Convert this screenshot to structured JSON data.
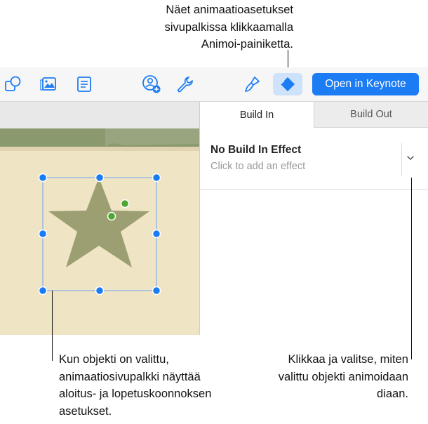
{
  "callouts": {
    "top": [
      "Näet animaatioasetukset",
      "sivupalkissa klikkaamalla",
      "Animoi-painiketta."
    ],
    "bottom_left": [
      "Kun objekti on valittu,",
      "animaatiosivupalkki näyttää",
      "aloitus- ja lopetuskoonnoksen",
      "asetukset."
    ],
    "bottom_right": [
      "Klikkaa ja valitse, miten",
      "valittu objekti animoidaan",
      "diaan."
    ]
  },
  "toolbar": {
    "icons": [
      "shapes-icon",
      "media-icon",
      "text-box-icon",
      "collaborate-add-icon",
      "wrench-icon",
      "format-brush-icon",
      "animate-icon"
    ],
    "open_in_keynote_label": "Open in Keynote"
  },
  "sidebar": {
    "tabs": [
      {
        "label": "Build In",
        "active": true
      },
      {
        "label": "Build Out",
        "active": false
      }
    ],
    "effect": {
      "title": "No Build In Effect",
      "subtitle": "Click to add an effect"
    }
  },
  "colors": {
    "accent": "#1c7cf4",
    "animate_button_bg": "#cfe2fb",
    "star_fill": "#9c9f72",
    "slide_bg": "#efe4c4",
    "handle_blue": "#1a7cf5",
    "rotation_handle_green": "#4fa632"
  }
}
